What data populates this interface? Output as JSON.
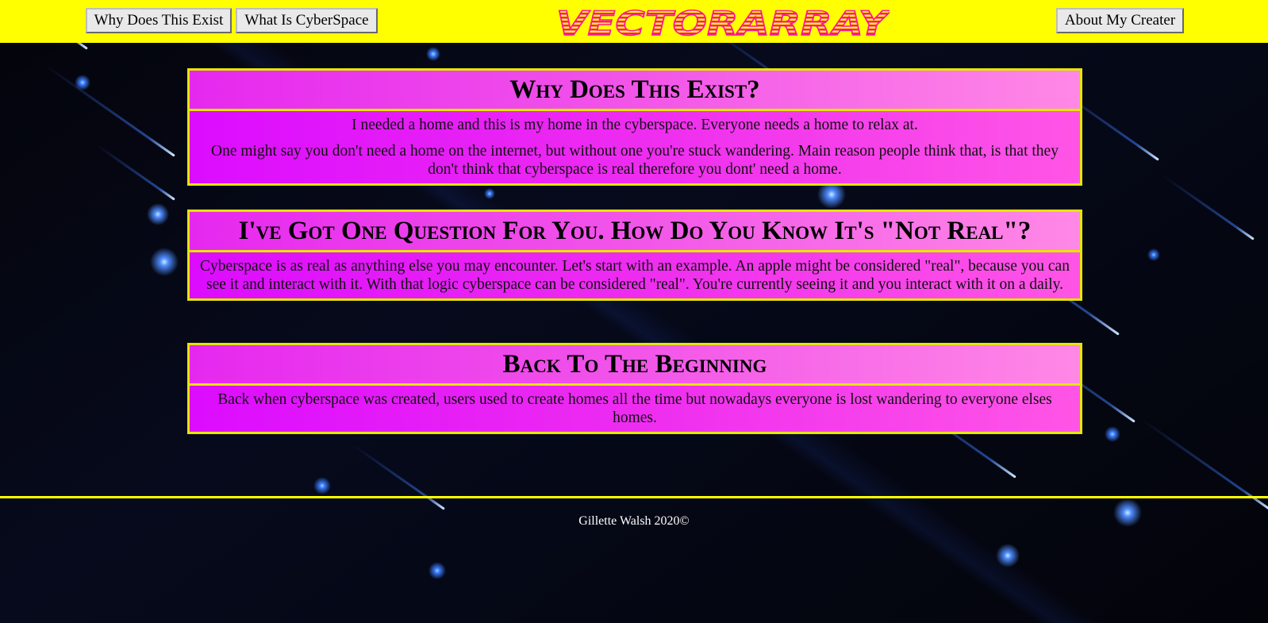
{
  "nav": {
    "left_buttons": [
      "Why Does This Exist",
      "What Is CyberSpace"
    ],
    "right_button": "About My Creater",
    "logo_text": "VECTORARRAY"
  },
  "sections": [
    {
      "heading": "Why Does This Exist?",
      "paragraphs": [
        "I needed a home and this is my home in the cyberspace. Everyone needs a home to relax at.",
        "One might say you don't need a home on the internet, but without one you're stuck wandering. Main reason people think that, is that they don't think that cyberspace is real therefore you dont' need a home."
      ]
    },
    {
      "heading": "I've Got One Question For You. How Do You Know It's \"Not Real\"?",
      "paragraphs": [
        "Cyberspace is as real as anything else you may encounter. Let's start with an example. An apple might be considered \"real\", because you can see it and interact with it. With that logic cyberspace can be considered \"real\". You're currently seeing it and you interact with it on a daily."
      ]
    },
    {
      "heading": "Back To The Beginning",
      "paragraphs": [
        "Back when cyberspace was created, users used to create homes all the time but nowadays everyone is lost wandering to everyone elses homes."
      ]
    }
  ],
  "footer": {
    "text": "Gillette Walsh 2020©"
  },
  "colors": {
    "topbar": "#ffff00",
    "card_border": "#e6e600",
    "card_magenta": "#e628ef",
    "card_pink": "#ff88e6",
    "background": "#04040a"
  }
}
